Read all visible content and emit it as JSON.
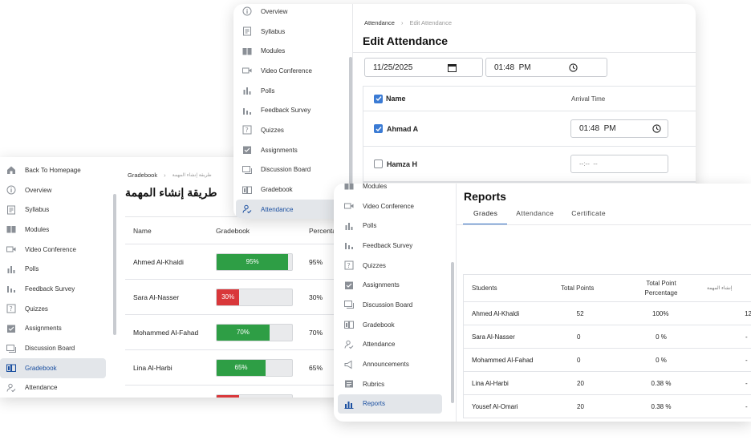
{
  "left": {
    "nav": [
      {
        "label": "Back To Homepage",
        "icon": "home-icon"
      },
      {
        "label": "Overview",
        "icon": "info-icon"
      },
      {
        "label": "Syllabus",
        "icon": "document-icon"
      },
      {
        "label": "Modules",
        "icon": "book-icon"
      },
      {
        "label": "Video Conference",
        "icon": "video-icon"
      },
      {
        "label": "Polls",
        "icon": "poll-icon"
      },
      {
        "label": "Feedback Survey",
        "icon": "chart-icon"
      },
      {
        "label": "Quizzes",
        "icon": "quiz-icon"
      },
      {
        "label": "Assignments",
        "icon": "assignment-icon"
      },
      {
        "label": "Discussion Board",
        "icon": "discussion-icon"
      },
      {
        "label": "Gradebook",
        "icon": "gradebook-icon"
      },
      {
        "label": "Attendance",
        "icon": "attendance-icon"
      }
    ],
    "active_index": 10,
    "breadcrumb": {
      "root": "Gradebook",
      "current": "طريقة إنشاء المهمة"
    },
    "title": "طريقة إنشاء المهمة",
    "table": {
      "headers": [
        "Name",
        "Gradebook",
        "Percenta"
      ],
      "rows": [
        {
          "name": "Ahmed Al-Khaldi",
          "label": "95%",
          "pct": "95%",
          "value": 0.95,
          "color": "#2e9e45"
        },
        {
          "name": "Sara Al-Nasser",
          "label": "30%",
          "pct": "30%",
          "value": 0.3,
          "color": "#d9373a"
        },
        {
          "name": "Mohammed Al-Fahad",
          "label": "70%",
          "pct": "70%",
          "value": 0.7,
          "color": "#2e9e45"
        },
        {
          "name": "Lina Al-Harbi",
          "label": "65%",
          "pct": "65%",
          "value": 0.65,
          "color": "#2e9e45"
        },
        {
          "name": "",
          "label": "",
          "pct": "",
          "value": 0.3,
          "color": "#d9373a"
        }
      ]
    }
  },
  "top": {
    "nav": [
      {
        "label": "Overview",
        "icon": "info-icon"
      },
      {
        "label": "Syllabus",
        "icon": "document-icon"
      },
      {
        "label": "Modules",
        "icon": "book-icon"
      },
      {
        "label": "Video Conference",
        "icon": "video-icon"
      },
      {
        "label": "Polls",
        "icon": "poll-icon"
      },
      {
        "label": "Feedback Survey",
        "icon": "chart-icon"
      },
      {
        "label": "Quizzes",
        "icon": "quiz-icon"
      },
      {
        "label": "Assignments",
        "icon": "assignment-icon"
      },
      {
        "label": "Discussion Board",
        "icon": "discussion-icon"
      },
      {
        "label": "Gradebook",
        "icon": "gradebook-icon"
      },
      {
        "label": "Attendance",
        "icon": "attendance-icon"
      }
    ],
    "active_index": 10,
    "breadcrumb": {
      "root": "Attendance",
      "current": "Edit Attendance"
    },
    "title": "Edit Attendance",
    "date_value": "11/25/2025",
    "time_value": "01:48  PM",
    "table": {
      "header_name": "Name",
      "header_time": "Arrival Time",
      "rows": [
        {
          "name": "Ahmad A",
          "checked": true,
          "time": "01:48  PM"
        },
        {
          "name": "Hamza H",
          "checked": false,
          "time": "--:--  --"
        }
      ]
    }
  },
  "reports": {
    "nav": [
      {
        "label": "Modules",
        "icon": "book-icon"
      },
      {
        "label": "Video Conference",
        "icon": "video-icon"
      },
      {
        "label": "Polls",
        "icon": "poll-icon"
      },
      {
        "label": "Feedback Survey",
        "icon": "chart-icon"
      },
      {
        "label": "Quizzes",
        "icon": "quiz-icon"
      },
      {
        "label": "Assignments",
        "icon": "assignment-icon"
      },
      {
        "label": "Discussion Board",
        "icon": "discussion-icon"
      },
      {
        "label": "Gradebook",
        "icon": "gradebook-icon"
      },
      {
        "label": "Attendance",
        "icon": "attendance-icon"
      },
      {
        "label": "Announcements",
        "icon": "announcement-icon"
      },
      {
        "label": "Rubrics",
        "icon": "rubric-icon"
      },
      {
        "label": "Reports",
        "icon": "reports-icon"
      }
    ],
    "active_index": 11,
    "title": "Reports",
    "tabs": [
      "Grades",
      "Attendance",
      "Certificate"
    ],
    "headers": [
      "Students",
      "Total Points",
      "Total Point\nPercentage",
      "إنشاء المهمة"
    ],
    "rows": [
      {
        "name": "Ahmed Al-Khaldi",
        "points": "52",
        "pct": "100%",
        "extra": "12"
      },
      {
        "name": "Sara Al-Nasser",
        "points": "0",
        "pct": "0 %",
        "extra": "-"
      },
      {
        "name": "Mohammed Al-Fahad",
        "points": "0",
        "pct": "0 %",
        "extra": "-"
      },
      {
        "name": "Lina Al-Harbi",
        "points": "20",
        "pct": "0.38 %",
        "extra": "-"
      },
      {
        "name": "Yousef Al-Omari",
        "points": "20",
        "pct": "0.38 %",
        "extra": "-"
      }
    ]
  }
}
